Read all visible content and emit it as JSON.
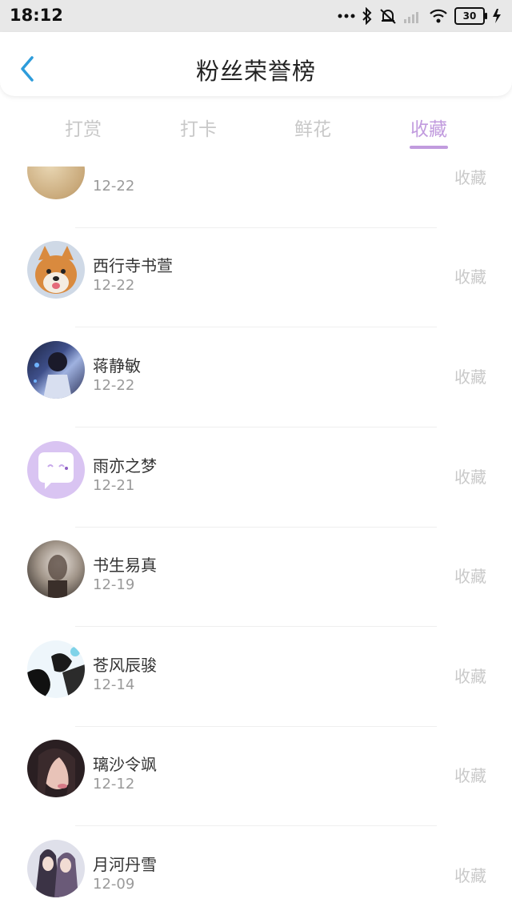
{
  "status_bar": {
    "time": "18:12",
    "battery": "30"
  },
  "header": {
    "title": "粉丝荣誉榜",
    "back_icon": "chevron-left-icon"
  },
  "tabs": [
    {
      "label": "打赏"
    },
    {
      "label": "打卡"
    },
    {
      "label": "鲜花"
    },
    {
      "label": "收藏",
      "active": true
    }
  ],
  "fans": [
    {
      "name": "",
      "date": "12-22",
      "action": "收藏"
    },
    {
      "name": "西行寺书萱",
      "date": "12-22",
      "action": "收藏"
    },
    {
      "name": "蒋静敏",
      "date": "12-22",
      "action": "收藏"
    },
    {
      "name": "雨亦之梦",
      "date": "12-21",
      "action": "收藏"
    },
    {
      "name": "书生易真",
      "date": "12-19",
      "action": "收藏"
    },
    {
      "name": "苍风辰骏",
      "date": "12-14",
      "action": "收藏"
    },
    {
      "name": "璃沙令飒",
      "date": "12-12",
      "action": "收藏"
    },
    {
      "name": "月河丹雪",
      "date": "12-09",
      "action": "收藏"
    }
  ],
  "colors": {
    "accent": "#c19bde",
    "inactive_tab": "#c8c8c8",
    "back_arrow": "#2d9cdb"
  }
}
